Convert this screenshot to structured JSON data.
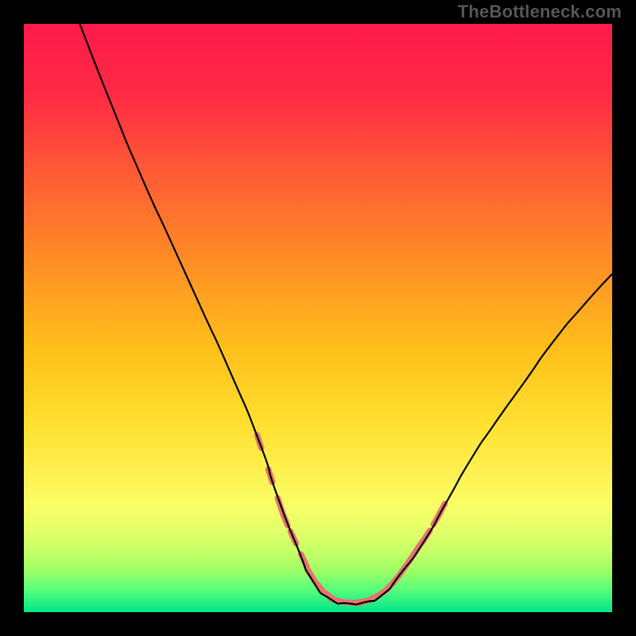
{
  "attribution": "TheBottleneck.com",
  "gradient": {
    "stops": [
      {
        "offset": 0,
        "color": "#ff1a4a"
      },
      {
        "offset": 12,
        "color": "#ff2a44"
      },
      {
        "offset": 25,
        "color": "#ff5a35"
      },
      {
        "offset": 40,
        "color": "#ff8c25"
      },
      {
        "offset": 55,
        "color": "#ffbf1a"
      },
      {
        "offset": 68,
        "color": "#ffe030"
      },
      {
        "offset": 76,
        "color": "#fff050"
      },
      {
        "offset": 82,
        "color": "#f9ff66"
      },
      {
        "offset": 86,
        "color": "#e4ff68"
      },
      {
        "offset": 90,
        "color": "#c3ff66"
      },
      {
        "offset": 93,
        "color": "#9cff66"
      },
      {
        "offset": 96,
        "color": "#5cff7a"
      },
      {
        "offset": 100,
        "color": "#00e48a"
      }
    ]
  },
  "chart_data": {
    "type": "line",
    "title": "",
    "xlabel": "",
    "ylabel": "",
    "xlim": [
      0,
      100
    ],
    "ylim": [
      0,
      100
    ],
    "series": [
      {
        "name": "bottleneck-curve",
        "x": [
          9.5,
          15,
          20,
          25,
          30,
          35,
          40,
          43,
          46.5,
          49,
          52,
          55,
          58,
          61,
          64,
          68,
          72,
          76,
          80,
          85,
          90,
          95,
          100
        ],
        "y": [
          100,
          86,
          74,
          63,
          52,
          41,
          29,
          20,
          11,
          5.5,
          2.3,
          1.5,
          1.7,
          3.0,
          6.5,
          12,
          19,
          26,
          32,
          39,
          46,
          52,
          57.5
        ]
      }
    ],
    "marker_segments": [
      {
        "x_start": 40,
        "x_end": 50,
        "description": "left-descent-markers"
      },
      {
        "x_start": 50,
        "x_end": 62,
        "description": "valley-floor-markers"
      },
      {
        "x_start": 62,
        "x_end": 71,
        "description": "right-ascent-markers"
      }
    ],
    "marker_points": {
      "x": [
        40.0,
        41.9,
        43.5,
        44.4,
        45.8,
        47.6,
        48.8,
        50.4,
        51.8,
        53.2,
        56.0,
        57.0,
        58.2,
        59.4,
        60.8,
        62.0,
        63.0,
        64.4,
        66.0,
        67.2,
        68.4,
        70.2,
        71.0
      ],
      "y": [
        29.0,
        23.2,
        18.3,
        15.8,
        12.7,
        8.8,
        6.3,
        4.1,
        2.8,
        2.0,
        1.6,
        1.7,
        1.9,
        2.4,
        3.2,
        4.2,
        5.3,
        7.1,
        9.4,
        11.2,
        12.9,
        15.9,
        17.4
      ]
    },
    "marker_color": "#e5746e",
    "curve_color": "#000000"
  }
}
